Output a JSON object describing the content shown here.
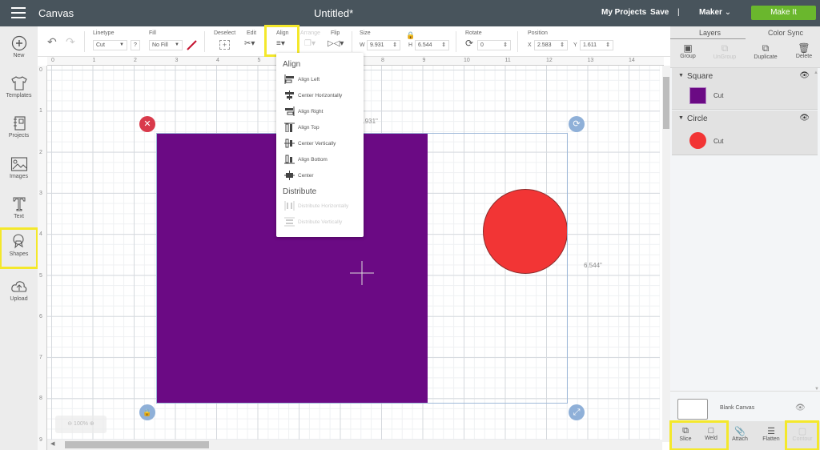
{
  "topbar": {
    "app_title": "Canvas",
    "doc_title": "Untitled*",
    "my_projects": "My Projects",
    "save": "Save",
    "separator": "|",
    "machine": "Maker",
    "make_it": "Make It"
  },
  "leftnav": [
    {
      "label": "New",
      "icon": "plus-circle-icon"
    },
    {
      "label": "Templates",
      "icon": "tshirt-icon"
    },
    {
      "label": "Projects",
      "icon": "notebook-icon"
    },
    {
      "label": "Images",
      "icon": "image-icon"
    },
    {
      "label": "Text",
      "icon": "text-t-icon"
    },
    {
      "label": "Shapes",
      "icon": "shapes-icon",
      "highlighted": true
    },
    {
      "label": "Upload",
      "icon": "cloud-upload-icon"
    }
  ],
  "toolbar": {
    "linetype_label": "Linetype",
    "linetype_value": "Cut",
    "help": "?",
    "fill_label": "Fill",
    "fill_value": "No Fill",
    "deselect_label": "Deselect",
    "edit_label": "Edit",
    "align_label": "Align",
    "arrange_label": "Arrange",
    "flip_label": "Flip",
    "size_label": "Size",
    "w_label": "W",
    "w_value": "9.931",
    "h_label": "H",
    "h_value": "6.544",
    "rotate_label": "Rotate",
    "rotate_value": "0",
    "position_label": "Position",
    "x_label": "X",
    "x_value": "2.583",
    "y_label": "Y",
    "y_value": "1.611"
  },
  "ruler": {
    "h": [
      "0",
      "1",
      "2",
      "3",
      "4",
      "5",
      "6",
      "7",
      "8",
      "9",
      "10",
      "11",
      "12",
      "13",
      "14"
    ],
    "v": [
      "0",
      "1",
      "2",
      "3",
      "4",
      "5",
      "6",
      "7",
      "8",
      "9"
    ]
  },
  "canvas": {
    "width_label": "9.931\"",
    "height_label": "6.544\"",
    "zoom": "100%",
    "square_color": "#6b0a84",
    "circle_color": "#f23535"
  },
  "align_menu": {
    "align_heading": "Align",
    "items": [
      "Align Left",
      "Center Horizontally",
      "Align Right",
      "Align Top",
      "Center Vertically",
      "Align Bottom",
      "Center"
    ],
    "distribute_heading": "Distribute",
    "distribute_items": [
      "Distribute Horizontally",
      "Distribute Vertically"
    ]
  },
  "panel": {
    "tabs": [
      "Layers",
      "Color Sync"
    ],
    "actions": [
      {
        "label": "Group",
        "enabled": true
      },
      {
        "label": "UnGroup",
        "enabled": false
      },
      {
        "label": "Duplicate",
        "enabled": true
      },
      {
        "label": "Delete",
        "enabled": true
      }
    ],
    "layers": [
      {
        "name": "Square",
        "sub": "Cut",
        "color": "#6b0a84",
        "shape": "square"
      },
      {
        "name": "Circle",
        "sub": "Cut",
        "color": "#f23535",
        "shape": "circle"
      }
    ],
    "blank_canvas": "Blank Canvas",
    "bottom_actions": [
      {
        "label": "Slice",
        "enabled": true
      },
      {
        "label": "Weld",
        "enabled": true
      },
      {
        "label": "Attach",
        "enabled": true
      },
      {
        "label": "Flatten",
        "enabled": true
      },
      {
        "label": "Contour",
        "enabled": false
      }
    ]
  },
  "colors": {
    "highlight": "#f4e82b",
    "make_it": "#6ab72d",
    "topbar": "#48545c"
  }
}
